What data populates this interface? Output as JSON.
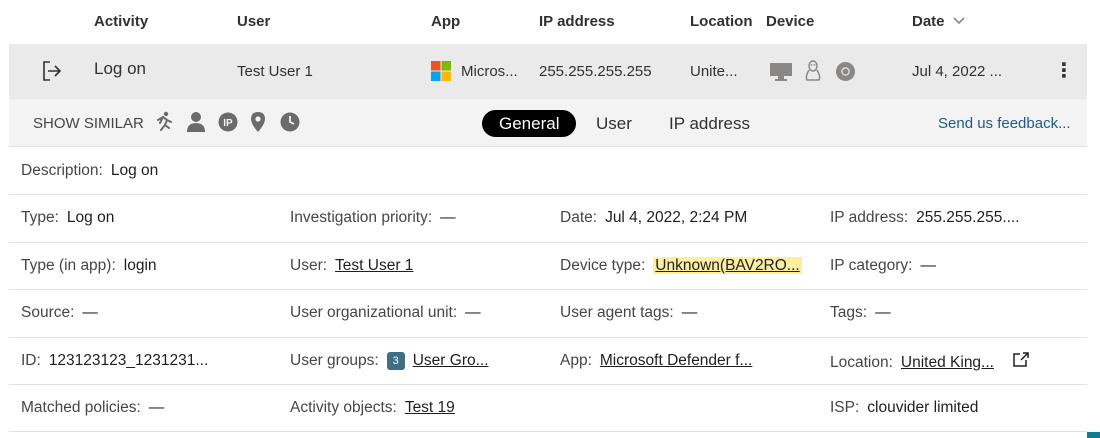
{
  "header": {
    "activity": "Activity",
    "user": "User",
    "app": "App",
    "ip": "IP address",
    "location": "Location",
    "device": "Device",
    "date": "Date"
  },
  "row": {
    "activity": "Log on",
    "user": "Test User 1",
    "app": "Micros...",
    "ip": "255.255.255.255",
    "location": "Unite...",
    "date": "Jul 4, 2022 ...",
    "more": "⋮"
  },
  "similar": {
    "label": "SHOW SIMILAR",
    "tabs": [
      "General",
      "User",
      "IP address"
    ],
    "feedback": "Send us feedback..."
  },
  "details": {
    "description": {
      "label": "Description:",
      "value": "Log on"
    },
    "rows": [
      [
        {
          "label": "Type:",
          "value": "Log on"
        },
        {
          "label": "Investigation priority:",
          "value": "—"
        },
        {
          "label": "Date:",
          "value": "Jul 4, 2022, 2:24 PM"
        },
        {
          "label": "IP address:",
          "value": "255.255.255...."
        }
      ],
      [
        {
          "label": "Type (in app):",
          "value": "login"
        },
        {
          "label": "User:",
          "value": "Test User 1"
        },
        {
          "label": "Device type:",
          "value": "Unknown(BAV2RO..."
        },
        {
          "label": "IP category:",
          "value": "—"
        }
      ],
      [
        {
          "label": "Source:",
          "value": "—"
        },
        {
          "label": "User organizational unit:",
          "value": "—"
        },
        {
          "label": "User agent tags:",
          "value": "—"
        },
        {
          "label": "Tags:",
          "value": "—"
        }
      ],
      [
        {
          "label": "ID:",
          "value": "123123123_1231231..."
        },
        {
          "label": "User groups:",
          "badge": "3",
          "value": "User Gro..."
        },
        {
          "label": "App:",
          "value": "Microsoft Defender f..."
        },
        {
          "label": "Location:",
          "value": "United King..."
        }
      ],
      [
        {
          "label": "Matched policies:",
          "value": "—"
        },
        {
          "label": "Activity objects:",
          "value": "Test 19"
        },
        {
          "label": "",
          "value": ""
        },
        {
          "label": "ISP:",
          "value": "clouvider limited"
        }
      ]
    ]
  },
  "colors": {
    "row_bg": "#eaeaea",
    "highlight": "#fbef9e",
    "badge": "#3f6e86",
    "link": "#1e5a8a"
  }
}
